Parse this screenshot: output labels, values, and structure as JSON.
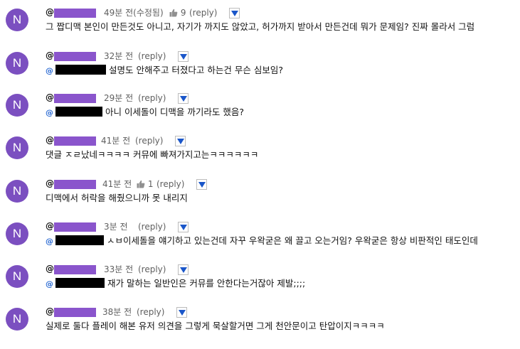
{
  "comments": [
    {
      "avatar": "N",
      "at": "@",
      "time": "49분 전(수정됨)",
      "likes": "9",
      "reply": "(reply)",
      "text": "그 짭디맥 본인이 만든것도 아니고, 자기가 까지도 않았고, 허가까지 받아서 만든건데 뭐가 문제임? 진짜 몰라서 그럼",
      "mention": ""
    },
    {
      "avatar": "N",
      "at": "@",
      "time": "32분 전",
      "likes": "",
      "reply": "(reply)",
      "text": "설명도 안해주고 터졌다고 하는건 무슨 심보임?",
      "mention": "@"
    },
    {
      "avatar": "N",
      "at": "@",
      "time": "29분 전",
      "likes": "",
      "reply": "(reply)",
      "text": "아니 이세돌이 디맥을 까기라도 했음?",
      "mention": "@"
    },
    {
      "avatar": "N",
      "at": "@",
      "time": "41분 전",
      "likes": "",
      "reply": "(reply)",
      "text": "댓글 ㅈㄹ났네ㅋㅋㅋㅋ 커뮤에 빠져가지고는ㅋㅋㅋㅋㅋㅋ",
      "mention": ""
    },
    {
      "avatar": "N",
      "at": "@",
      "time": "41분 전",
      "likes": "1",
      "reply": "(reply)",
      "text": "디맥에서 허락을 해줬으니까 못 내리지",
      "mention": ""
    },
    {
      "avatar": "N",
      "at": "@",
      "time": "3분 전",
      "likes": "",
      "reply": "(reply)",
      "text": "ㅅㅂ이세돌을 얘기하고 있는건데 자꾸 우왁굳은 왜 끌고 오는거임? 우왁굳은 항상 비판적인 태도인데",
      "mention": "@"
    },
    {
      "avatar": "N",
      "at": "@",
      "time": "33분 전",
      "likes": "",
      "reply": "(reply)",
      "text": "재가 말하는 일반인은 커뮤를 안한다는거잖아 제발;;;;",
      "mention": "@"
    },
    {
      "avatar": "N",
      "at": "@",
      "time": "38분 전",
      "likes": "",
      "reply": "(reply)",
      "text": "실제로 둘다 플레이 해본 유저 의견을 그렇게 묵살할거면 그게 천안문이고 탄압이지ㅋㅋㅋㅋ",
      "mention": ""
    }
  ],
  "colors": {
    "avatar": "#7b4fc0",
    "redact_name": "#8a55cc",
    "arrow": "#1a56c9",
    "mention": "#2a6ad3"
  },
  "icons": {
    "like": "thumbs-up-icon",
    "expand": "triangle-down-icon"
  }
}
